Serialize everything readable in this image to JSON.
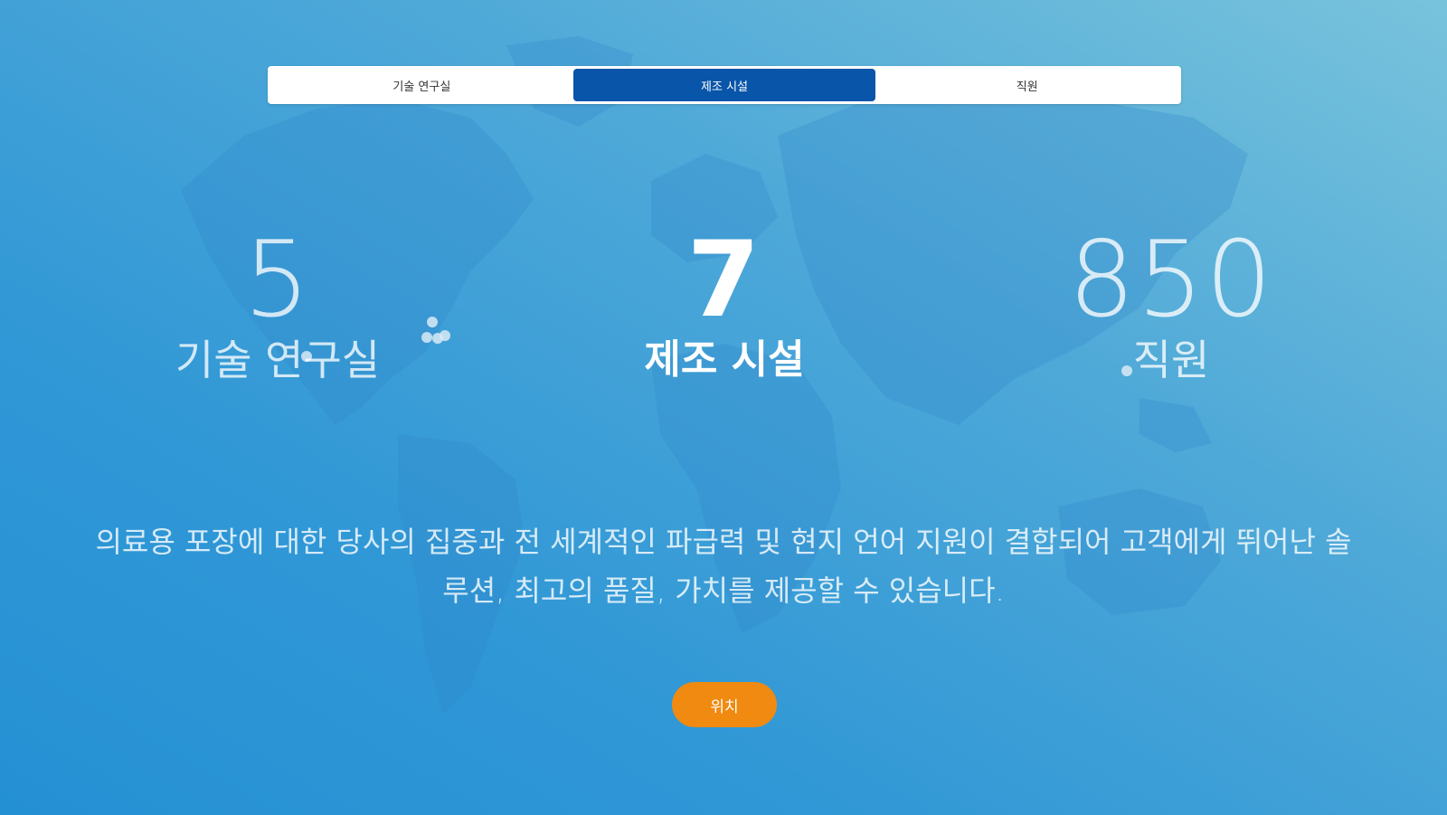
{
  "tabs": [
    {
      "label": "기술 연구실",
      "active": false
    },
    {
      "label": "제조 시설",
      "active": true
    },
    {
      "label": "직원",
      "active": false
    }
  ],
  "stats": {
    "labs": {
      "value": "5",
      "label": "기술 연구실"
    },
    "facilities": {
      "value": "7",
      "label": "제조 시설"
    },
    "employees": {
      "value": "850",
      "label": "직원"
    }
  },
  "description": "의료용 포장에 대한 당사의 집중과 전 세계적인 파급력 및 현지 언어 지원이 결합되어 고객에게 뛰어난 솔루션, 최고의 품질, 가치를 제공할 수 있습니다.",
  "cta": {
    "label": "위치"
  },
  "colors": {
    "background": "#3198d6",
    "active_tab": "#0855a9",
    "cta": "#f08a10"
  }
}
